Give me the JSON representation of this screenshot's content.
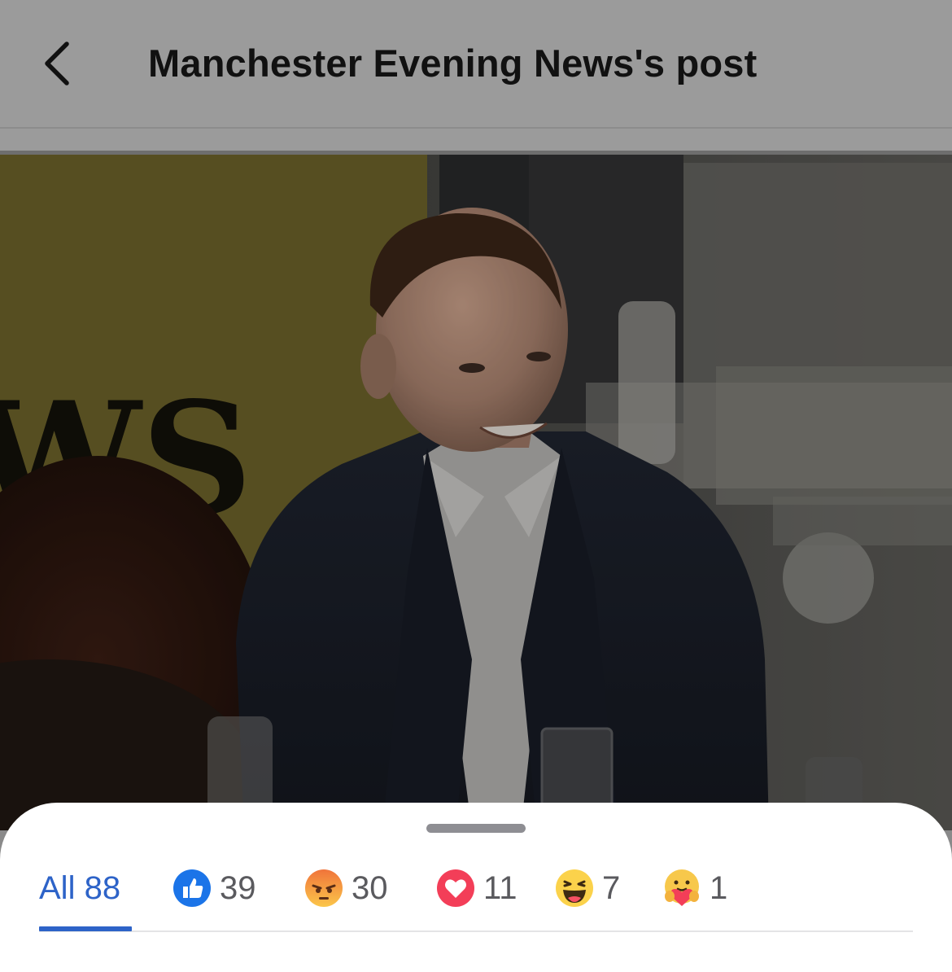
{
  "header": {
    "title": "Manchester Evening News's post",
    "back_icon": "chevron-left-icon"
  },
  "photo": {
    "backdrop_text": "WS",
    "backdrop_color": "#c7b64a"
  },
  "reactions": {
    "tabs": [
      {
        "id": "all",
        "label": "All 88",
        "active": true
      },
      {
        "id": "like",
        "icon": "like-icon",
        "count": "39",
        "color": "#1877f2"
      },
      {
        "id": "angry",
        "icon": "angry-icon",
        "count": "30",
        "color": "#f0743a"
      },
      {
        "id": "love",
        "icon": "love-icon",
        "count": "11",
        "color": "#f33e58"
      },
      {
        "id": "haha",
        "icon": "haha-icon",
        "count": "7",
        "color": "#fbd24b"
      },
      {
        "id": "care",
        "icon": "care-icon",
        "count": "1",
        "color": "#f7c84b"
      }
    ],
    "accent_color": "#2d63c8"
  }
}
